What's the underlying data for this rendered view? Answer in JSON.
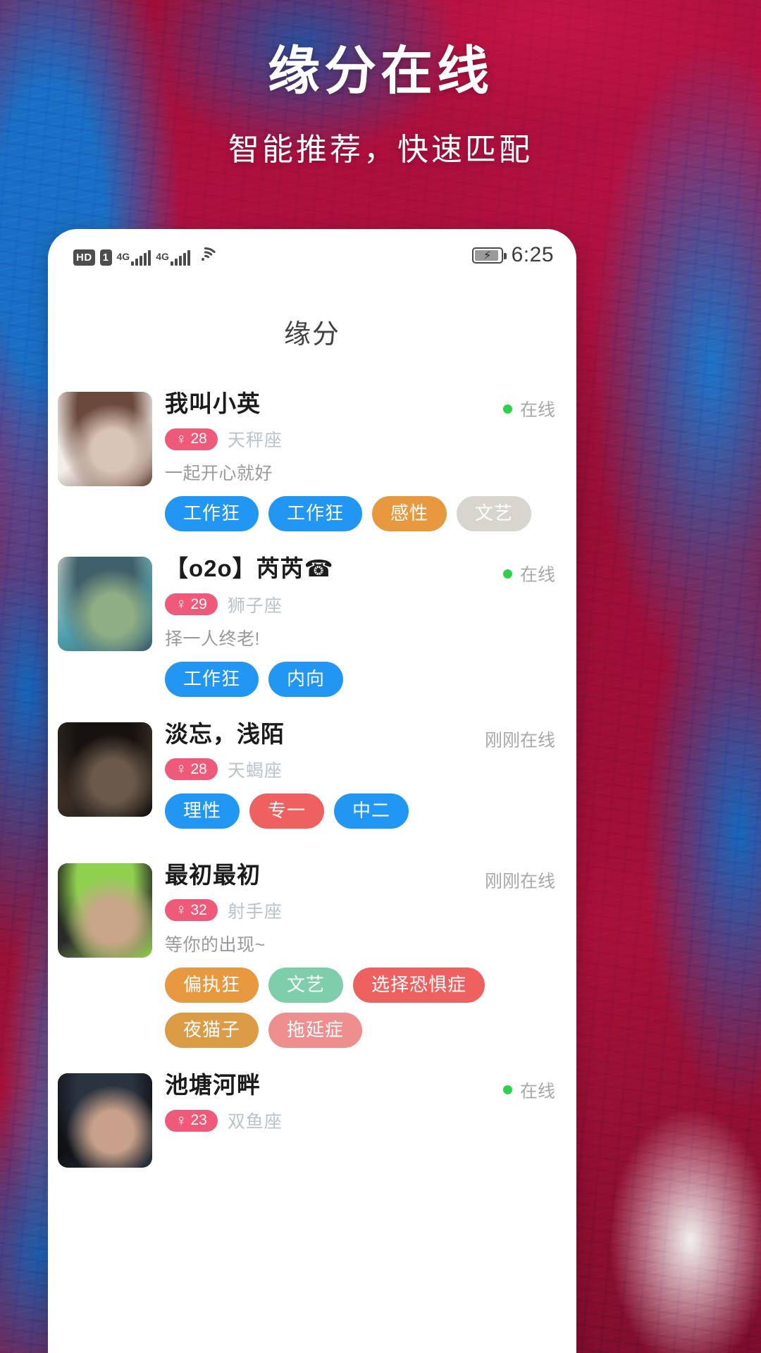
{
  "hero": {
    "title": "缘分在线",
    "subtitle": "智能推荐，快速匹配"
  },
  "statusbar": {
    "hd_label": "HD",
    "sim_label": "1",
    "net1": "4G",
    "net2": "4G",
    "wifi_icon": "wifi-icon",
    "battery_icon": "battery-charging-icon",
    "time": "6:25"
  },
  "screen": {
    "page_title": "缘分"
  },
  "colors": {
    "tag_blue": "#2196f3",
    "tag_orange": "#e8993f",
    "tag_gray": "#d8d5cf",
    "tag_red": "#ef6161",
    "tag_green": "#7fceab",
    "tag_pink": "#ef8e8e",
    "tag_amber": "#dc9b45",
    "age_pill": "#ef5a7a",
    "online_dot": "#2fd04a"
  },
  "profiles": [
    {
      "name": "我叫小英",
      "age": "28",
      "gender_symbol": "♀",
      "zodiac": "天秤座",
      "bio": "一起开心就好",
      "status": "在线",
      "online": true,
      "avatar_colors": [
        "#efe9e6",
        "#d9c5b8",
        "#6b4a3c",
        "#f3ece8"
      ],
      "tags": [
        {
          "label": "工作狂",
          "color": "#2196f3",
          "text_color": "#ffffff"
        },
        {
          "label": "工作狂",
          "color": "#2196f3",
          "text_color": "#ffffff"
        },
        {
          "label": "感性",
          "color": "#e8993f",
          "text_color": "#ffffff"
        },
        {
          "label": "文艺",
          "color": "#d8d5cf",
          "text_color": "#ffffff"
        }
      ]
    },
    {
      "name": "【o2o】芮芮☎",
      "age": "29",
      "gender_symbol": "♀",
      "zodiac": "狮子座",
      "bio": "择一人终老!",
      "status": "在线",
      "online": true,
      "avatar_colors": [
        "#cfd9c9",
        "#8fae86",
        "#3f5f6a",
        "#4fa0ad"
      ],
      "tags": [
        {
          "label": "工作狂",
          "color": "#2196f3",
          "text_color": "#ffffff"
        },
        {
          "label": "内向",
          "color": "#2196f3",
          "text_color": "#ffffff"
        }
      ]
    },
    {
      "name": "淡忘，浅陌",
      "age": "28",
      "gender_symbol": "♀",
      "zodiac": "天蝎座",
      "bio": "",
      "status": "刚刚在线",
      "online": false,
      "avatar_colors": [
        "#2a2420",
        "#6b5a4c",
        "#17120f",
        "#3a2e26"
      ],
      "tags": [
        {
          "label": "理性",
          "color": "#2196f3",
          "text_color": "#ffffff"
        },
        {
          "label": "专一",
          "color": "#ef6161",
          "text_color": "#ffffff"
        },
        {
          "label": "中二",
          "color": "#2196f3",
          "text_color": "#ffffff"
        }
      ]
    },
    {
      "name": "最初最初",
      "age": "32",
      "gender_symbol": "♀",
      "zodiac": "射手座",
      "bio": "等你的出现~",
      "status": "刚刚在线",
      "online": false,
      "avatar_colors": [
        "#1a1a1a",
        "#c9a58a",
        "#8fd14f",
        "#2b2b2b"
      ],
      "tags": [
        {
          "label": "偏执狂",
          "color": "#e8993f",
          "text_color": "#ffffff"
        },
        {
          "label": "文艺",
          "color": "#7fceab",
          "text_color": "#ffffff"
        },
        {
          "label": "选择恐惧症",
          "color": "#ef6161",
          "text_color": "#ffffff"
        },
        {
          "label": "夜猫子",
          "color": "#dc9b45",
          "text_color": "#ffffff"
        },
        {
          "label": "拖延症",
          "color": "#ef8e8e",
          "text_color": "#ffffff"
        }
      ]
    },
    {
      "name": "池塘河畔",
      "age": "23",
      "gender_symbol": "♀",
      "zodiac": "双鱼座",
      "bio": "",
      "status": "在线",
      "online": true,
      "avatar_colors": [
        "#14161c",
        "#c9a18a",
        "#2a3340",
        "#0f1116"
      ],
      "tags": []
    }
  ]
}
